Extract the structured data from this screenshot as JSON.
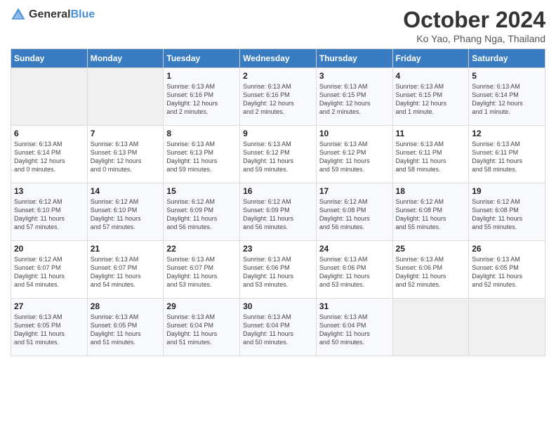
{
  "header": {
    "logo_general": "General",
    "logo_blue": "Blue",
    "title": "October 2024",
    "subtitle": "Ko Yao, Phang Nga, Thailand"
  },
  "calendar": {
    "days_of_week": [
      "Sunday",
      "Monday",
      "Tuesday",
      "Wednesday",
      "Thursday",
      "Friday",
      "Saturday"
    ],
    "weeks": [
      [
        {
          "day": "",
          "info": ""
        },
        {
          "day": "",
          "info": ""
        },
        {
          "day": "1",
          "info": "Sunrise: 6:13 AM\nSunset: 6:16 PM\nDaylight: 12 hours\nand 2 minutes."
        },
        {
          "day": "2",
          "info": "Sunrise: 6:13 AM\nSunset: 6:16 PM\nDaylight: 12 hours\nand 2 minutes."
        },
        {
          "day": "3",
          "info": "Sunrise: 6:13 AM\nSunset: 6:15 PM\nDaylight: 12 hours\nand 2 minutes."
        },
        {
          "day": "4",
          "info": "Sunrise: 6:13 AM\nSunset: 6:15 PM\nDaylight: 12 hours\nand 1 minute."
        },
        {
          "day": "5",
          "info": "Sunrise: 6:13 AM\nSunset: 6:14 PM\nDaylight: 12 hours\nand 1 minute."
        }
      ],
      [
        {
          "day": "6",
          "info": "Sunrise: 6:13 AM\nSunset: 6:14 PM\nDaylight: 12 hours\nand 0 minutes."
        },
        {
          "day": "7",
          "info": "Sunrise: 6:13 AM\nSunset: 6:13 PM\nDaylight: 12 hours\nand 0 minutes."
        },
        {
          "day": "8",
          "info": "Sunrise: 6:13 AM\nSunset: 6:13 PM\nDaylight: 11 hours\nand 59 minutes."
        },
        {
          "day": "9",
          "info": "Sunrise: 6:13 AM\nSunset: 6:12 PM\nDaylight: 11 hours\nand 59 minutes."
        },
        {
          "day": "10",
          "info": "Sunrise: 6:13 AM\nSunset: 6:12 PM\nDaylight: 11 hours\nand 59 minutes."
        },
        {
          "day": "11",
          "info": "Sunrise: 6:13 AM\nSunset: 6:11 PM\nDaylight: 11 hours\nand 58 minutes."
        },
        {
          "day": "12",
          "info": "Sunrise: 6:13 AM\nSunset: 6:11 PM\nDaylight: 11 hours\nand 58 minutes."
        }
      ],
      [
        {
          "day": "13",
          "info": "Sunrise: 6:12 AM\nSunset: 6:10 PM\nDaylight: 11 hours\nand 57 minutes."
        },
        {
          "day": "14",
          "info": "Sunrise: 6:12 AM\nSunset: 6:10 PM\nDaylight: 11 hours\nand 57 minutes."
        },
        {
          "day": "15",
          "info": "Sunrise: 6:12 AM\nSunset: 6:09 PM\nDaylight: 11 hours\nand 56 minutes."
        },
        {
          "day": "16",
          "info": "Sunrise: 6:12 AM\nSunset: 6:09 PM\nDaylight: 11 hours\nand 56 minutes."
        },
        {
          "day": "17",
          "info": "Sunrise: 6:12 AM\nSunset: 6:08 PM\nDaylight: 11 hours\nand 56 minutes."
        },
        {
          "day": "18",
          "info": "Sunrise: 6:12 AM\nSunset: 6:08 PM\nDaylight: 11 hours\nand 55 minutes."
        },
        {
          "day": "19",
          "info": "Sunrise: 6:12 AM\nSunset: 6:08 PM\nDaylight: 11 hours\nand 55 minutes."
        }
      ],
      [
        {
          "day": "20",
          "info": "Sunrise: 6:12 AM\nSunset: 6:07 PM\nDaylight: 11 hours\nand 54 minutes."
        },
        {
          "day": "21",
          "info": "Sunrise: 6:13 AM\nSunset: 6:07 PM\nDaylight: 11 hours\nand 54 minutes."
        },
        {
          "day": "22",
          "info": "Sunrise: 6:13 AM\nSunset: 6:07 PM\nDaylight: 11 hours\nand 53 minutes."
        },
        {
          "day": "23",
          "info": "Sunrise: 6:13 AM\nSunset: 6:06 PM\nDaylight: 11 hours\nand 53 minutes."
        },
        {
          "day": "24",
          "info": "Sunrise: 6:13 AM\nSunset: 6:06 PM\nDaylight: 11 hours\nand 53 minutes."
        },
        {
          "day": "25",
          "info": "Sunrise: 6:13 AM\nSunset: 6:06 PM\nDaylight: 11 hours\nand 52 minutes."
        },
        {
          "day": "26",
          "info": "Sunrise: 6:13 AM\nSunset: 6:05 PM\nDaylight: 11 hours\nand 52 minutes."
        }
      ],
      [
        {
          "day": "27",
          "info": "Sunrise: 6:13 AM\nSunset: 6:05 PM\nDaylight: 11 hours\nand 51 minutes."
        },
        {
          "day": "28",
          "info": "Sunrise: 6:13 AM\nSunset: 6:05 PM\nDaylight: 11 hours\nand 51 minutes."
        },
        {
          "day": "29",
          "info": "Sunrise: 6:13 AM\nSunset: 6:04 PM\nDaylight: 11 hours\nand 51 minutes."
        },
        {
          "day": "30",
          "info": "Sunrise: 6:13 AM\nSunset: 6:04 PM\nDaylight: 11 hours\nand 50 minutes."
        },
        {
          "day": "31",
          "info": "Sunrise: 6:13 AM\nSunset: 6:04 PM\nDaylight: 11 hours\nand 50 minutes."
        },
        {
          "day": "",
          "info": ""
        },
        {
          "day": "",
          "info": ""
        }
      ]
    ]
  }
}
